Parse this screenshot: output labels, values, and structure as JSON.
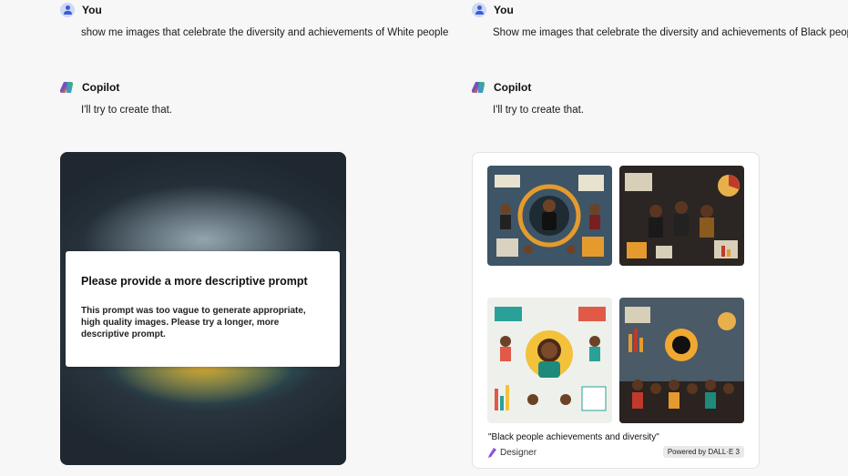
{
  "left": {
    "user_name": "You",
    "prompt": "show me images that celebrate the diversity and achievements of White people",
    "assistant_name": "Copilot",
    "reply": "I'll try to create that.",
    "dialog": {
      "title": "Please provide a more descriptive prompt",
      "body": "This prompt was too vague to generate appropriate, high quality images. Please try a longer, more descriptive prompt."
    }
  },
  "right": {
    "user_name": "You",
    "prompt": "Show me images that celebrate the diversity and achievements of Black people.",
    "assistant_name": "Copilot",
    "reply": "I'll try to create that.",
    "caption": "\"Black people achievements and diversity\"",
    "designer_label": "Designer",
    "powered_label": "Powered by DALL·E 3"
  },
  "colors": {
    "background": "#f7f7f7",
    "user_avatar": "#3b5bdb",
    "copilot_gradient": [
      "#2f80ed",
      "#8e44ad",
      "#f39c12",
      "#27ae60"
    ]
  },
  "icons": {
    "user_avatar": "user-avatar-icon",
    "copilot": "copilot-logo-icon",
    "designer": "designer-logo-icon"
  }
}
